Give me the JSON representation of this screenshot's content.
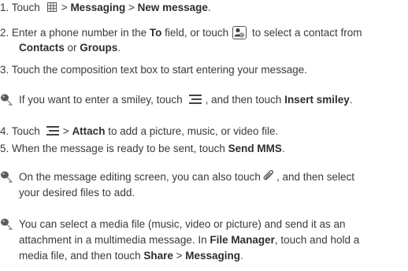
{
  "step1": {
    "a": "1. Touch",
    "b": "> ",
    "c": "Messaging",
    "d": " > ",
    "e": "New message",
    "f": "."
  },
  "step2": {
    "a": "2. Enter a phone number in the ",
    "b": "To",
    "c": " field, or touch",
    "d": " to select a contact from",
    "e": "Contacts",
    "f": " or ",
    "g": "Groups",
    "h": "."
  },
  "step3": {
    "a": "3. Touch the composition text box to start entering your message."
  },
  "note1": {
    "a": "If you want to enter a smiley, touch",
    "b": ", and then touch ",
    "c": "Insert smiley",
    "d": "."
  },
  "step4": {
    "a": "4. Touch",
    "b": "> ",
    "c": "Attach",
    "d": " to add a picture, music, or video file."
  },
  "step5": {
    "a": "5. When the message is ready to be sent, touch ",
    "b": "Send MMS",
    "c": "."
  },
  "note2": {
    "a": "On the message editing screen, you can also touch",
    "b": ", and then select",
    "c": "your desired files to add."
  },
  "note3": {
    "a": "You can select a media file (music, video or picture) and send it as an",
    "b": "attachment in a multimedia message. In ",
    "c": "File Manager",
    "d": ", touch and hold a",
    "e": "media file, and then touch ",
    "f": "Share",
    "g": " > ",
    "h": "Messaging",
    "i": "."
  },
  "icons": {
    "apps": "apps-grid-icon",
    "contact": "add-contact-icon",
    "menu": "menu-icon",
    "attach": "paperclip-icon",
    "note": "note-pin-icon"
  }
}
